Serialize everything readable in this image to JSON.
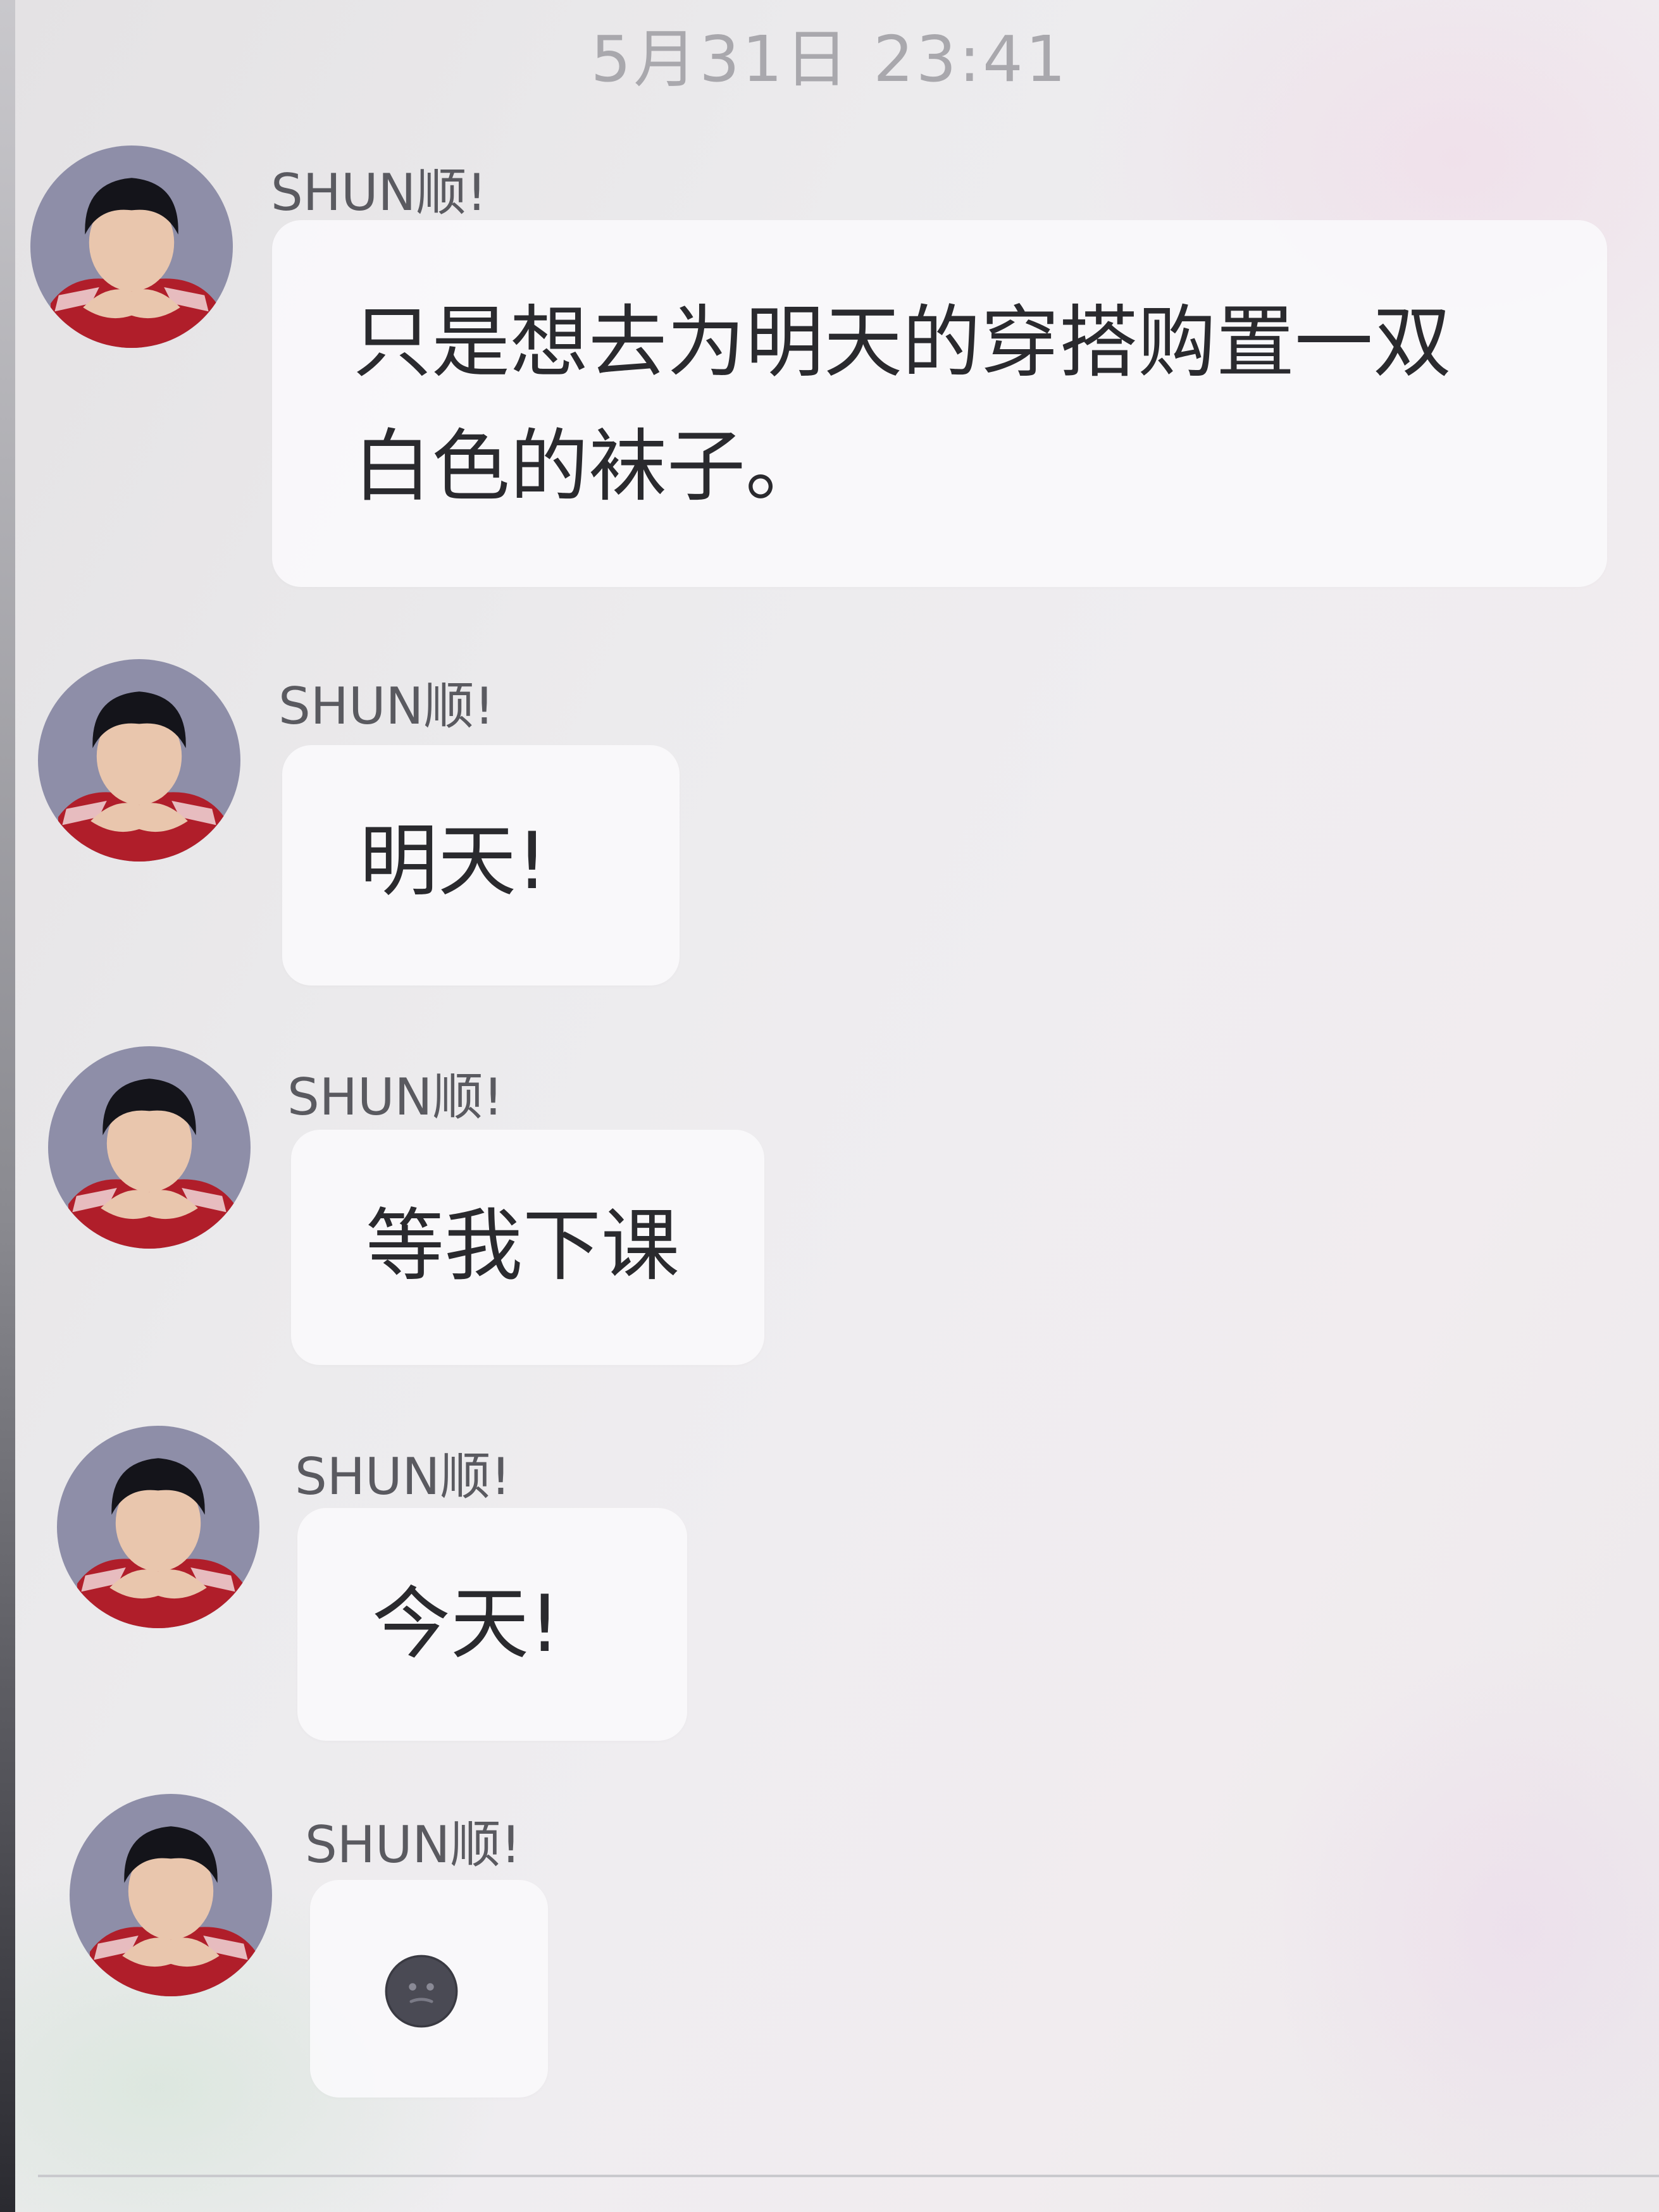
{
  "chat": {
    "timestamp": "5月31日 23:41",
    "messages": [
      {
        "sender": "SHUN顺!",
        "lines": [
          "只是想去为明天的穿搭购置一双",
          "白色的袜子。"
        ]
      },
      {
        "sender": "SHUN顺!",
        "lines": [
          "明天!"
        ]
      },
      {
        "sender": "SHUN顺!",
        "lines": [
          "等我下课"
        ]
      },
      {
        "sender": "SHUN顺!",
        "lines": [
          "今天!"
        ]
      },
      {
        "sender": "SHUN顺!",
        "emoji": "dark-face-emoji-icon"
      }
    ]
  },
  "colors": {
    "background": "#ecebed",
    "bubble": "#faf9fb",
    "text": "#2a2a2e",
    "sender": "#5a5a60",
    "timestamp": "#a9a8ad"
  }
}
